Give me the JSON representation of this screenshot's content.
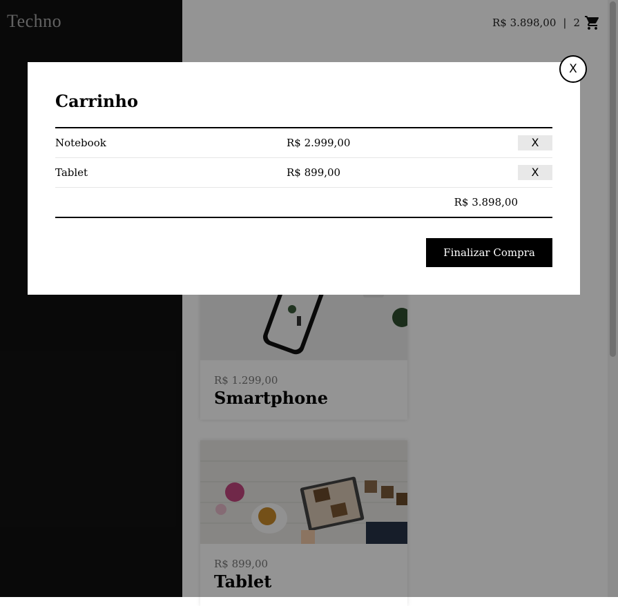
{
  "header": {
    "logo": "Techno",
    "cart_total": "R$ 3.898,00",
    "separator": "|",
    "cart_count": "2",
    "cart_icon": "cart-icon"
  },
  "products": [
    {
      "price": "R$ 1.299,00",
      "name": "Smartphone"
    },
    {
      "price": "R$ 899,00",
      "name": "Tablet"
    }
  ],
  "modal": {
    "title": "Carrinho",
    "close_label": "X",
    "items": [
      {
        "name": "Notebook",
        "price": "R$ 2.999,00",
        "remove_label": "X"
      },
      {
        "name": "Tablet",
        "price": "R$ 899,00",
        "remove_label": "X"
      }
    ],
    "total": "R$ 3.898,00",
    "finalize_label": "Finalizar Compra"
  }
}
